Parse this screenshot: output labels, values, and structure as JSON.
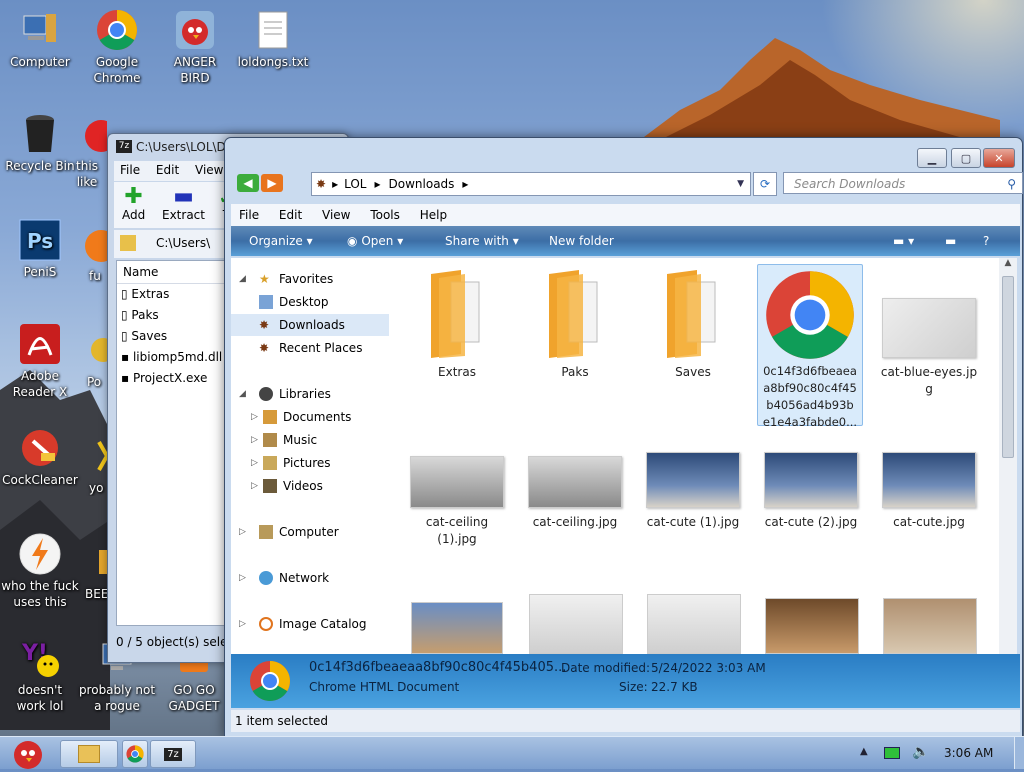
{
  "desktop": {
    "icons": [
      {
        "label": "Computer"
      },
      {
        "label": "Google Chrome"
      },
      {
        "label": "ANGER BIRD"
      },
      {
        "label": "loldongs.txt"
      },
      {
        "label": "Recycle Bin"
      },
      {
        "label": "this like"
      },
      {
        "label": "PeniS"
      },
      {
        "label": "fu"
      },
      {
        "label": "Adobe Reader X"
      },
      {
        "label": "Po"
      },
      {
        "label": "CockCleaner"
      },
      {
        "label": "yo"
      },
      {
        "label": "who the fuck uses this"
      },
      {
        "label": "BEE"
      },
      {
        "label": "doesn't work lol"
      },
      {
        "label": "probably not a rogue"
      },
      {
        "label": "GO GO GADGET"
      }
    ]
  },
  "sevenzip": {
    "title": "C:\\Users\\LOL\\D",
    "menu": [
      "File",
      "Edit",
      "View"
    ],
    "tools": {
      "add": "Add",
      "extract": "Extract",
      "test": "T"
    },
    "address": "C:\\Users\\",
    "column_name": "Name",
    "files": [
      "Extras",
      "Paks",
      "Saves",
      "libiomp5md.dll",
      "ProjectX.exe"
    ],
    "status": "0 / 5 object(s) sele"
  },
  "explorer": {
    "breadcrumb": [
      "LOL",
      "Downloads"
    ],
    "search_placeholder": "Search Downloads",
    "menu": [
      "File",
      "Edit",
      "View",
      "Tools",
      "Help"
    ],
    "commands": {
      "organize": "Organize",
      "open": "Open",
      "share": "Share with",
      "new_folder": "New folder"
    },
    "nav": {
      "favorites": "Favorites",
      "desktop": "Desktop",
      "downloads": "Downloads",
      "recent": "Recent Places",
      "libraries": "Libraries",
      "documents": "Documents",
      "music": "Music",
      "pictures": "Pictures",
      "videos": "Videos",
      "computer": "Computer",
      "network": "Network",
      "image_catalog": "Image Catalog"
    },
    "files": [
      {
        "name": "Extras",
        "kind": "folder"
      },
      {
        "name": "Paks",
        "kind": "folder"
      },
      {
        "name": "Saves",
        "kind": "folder"
      },
      {
        "name": "0c14f3d6fbeaea a8bf90c80c4f45 b4056ad4b93b e1e4a3fabde0...",
        "kind": "chrome"
      },
      {
        "name": "cat-blue-eyes.jp g",
        "kind": "image"
      },
      {
        "name": "cat-ceiling (1).jpg",
        "kind": "image"
      },
      {
        "name": "cat-ceiling.jpg",
        "kind": "image"
      },
      {
        "name": "cat-cute (1).jpg",
        "kind": "image"
      },
      {
        "name": "cat-cute (2).jpg",
        "kind": "image"
      },
      {
        "name": "cat-cute.jpg",
        "kind": "image"
      }
    ],
    "details": {
      "name": "0c14f3d6fbeaeaa8bf90c80c4f45b405...",
      "type": "Chrome HTML Document",
      "modified_label": "Date modified:",
      "modified": "5/24/2022 3:03 AM",
      "size_label": "Size:",
      "size": "22.7 KB"
    },
    "status": "1 item selected"
  },
  "taskbar": {
    "clock": "3:06 AM"
  },
  "colors": {
    "accent": "#3c6ea6",
    "selection": "#d9ebfb"
  }
}
